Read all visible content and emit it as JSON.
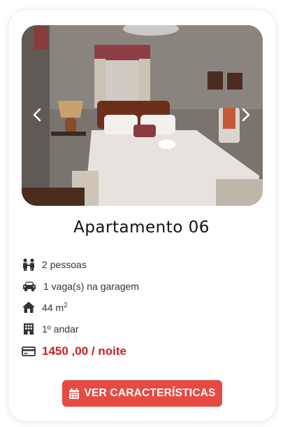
{
  "listing": {
    "title": "Apartamento 06",
    "features": {
      "people": "2 pessoas",
      "parking": "1 vaga(s) na garagem",
      "area": "44 m",
      "area_exp": "2",
      "floor": "1º andar",
      "price": "1450 ,00 / noite"
    },
    "button_label": "VER CARACTERÍSTICAS"
  },
  "icons": {
    "prev": "chevron-left-icon",
    "next": "chevron-right-icon",
    "people": "people-icon",
    "parking": "car-icon",
    "area": "house-icon",
    "floor": "building-icon",
    "price": "credit-card-icon",
    "button": "calendar-icon"
  },
  "colors": {
    "accent": "#e74a43",
    "price": "#cc1f1f"
  }
}
